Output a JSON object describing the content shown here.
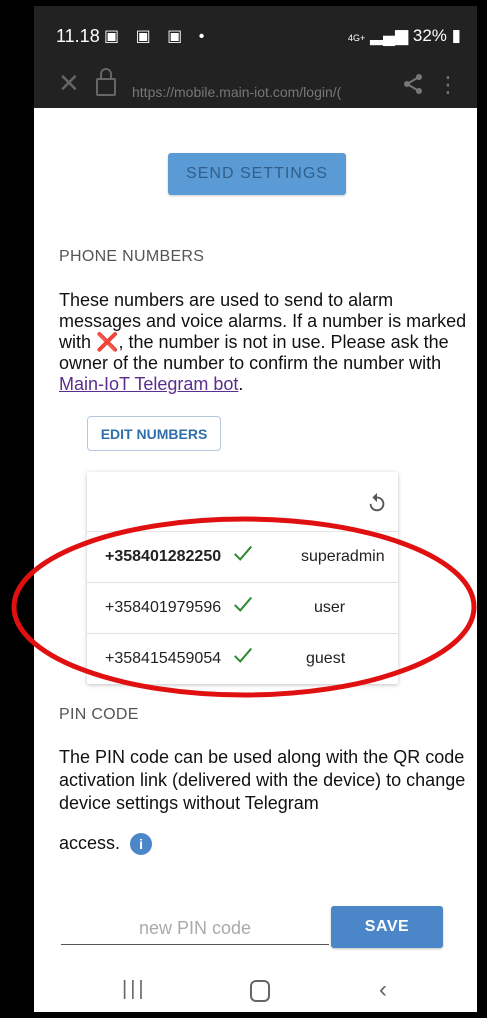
{
  "status_bar": {
    "time": "11.18",
    "notification_icons": "▣ ▣ ▣ •",
    "network": "4G+",
    "battery": "32%"
  },
  "browser": {
    "url": "https://mobile.main-iot.com/login/(",
    "close_icon": "close-icon",
    "lock_icon": "lock-icon",
    "share_icon": "share-icon",
    "more_icon": "more-vert-icon"
  },
  "send_settings": {
    "label": "SEND SETTINGS"
  },
  "phone_numbers": {
    "title": "PHONE NUMBERS",
    "description_part1": "These numbers are used to send to alarm messages and voice alarms. If a number is marked with ",
    "x_mark": "❌",
    "description_part2": ", the number is not in use. Please ask the owner of the number to confirm the number with ",
    "bot_link": "Main-IoT Telegram bot",
    "description_end": ".",
    "edit_label": "EDIT NUMBERS",
    "rows": [
      {
        "phone": "+358401282250",
        "role": "superadmin",
        "bold": true
      },
      {
        "phone": "+358401979596",
        "role": "user",
        "bold": false
      },
      {
        "phone": "+358415459054",
        "role": "guest",
        "bold": false
      }
    ]
  },
  "pin_code": {
    "title": "PIN CODE",
    "description": "The PIN code can be used along with the QR code activation link (delivered with the device) to change device settings without Telegram",
    "description_tail": "access.",
    "info_icon": "i",
    "input_placeholder": "new PIN code",
    "save_label": "SAVE"
  },
  "colors": {
    "accent": "#4a86c8",
    "annotation": "#e01010",
    "check": "#2e8b2e"
  }
}
